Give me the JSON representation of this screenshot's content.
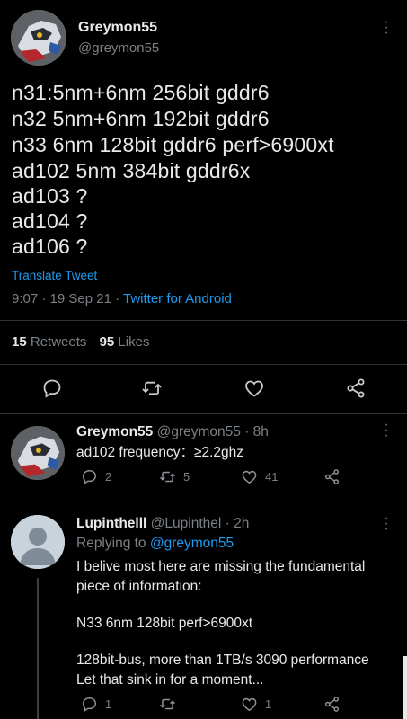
{
  "main_tweet": {
    "display_name": "Greymon55",
    "handle": "@greymon55",
    "lines": [
      "n31:5nm+6nm 256bit gddr6",
      "n32 5nm+6nm 192bit gddr6",
      "n33 6nm 128bit gddr6 perf>6900xt",
      "ad102 5nm 384bit gddr6x",
      "ad103 ?",
      "ad104 ?",
      "ad106 ?"
    ],
    "translate_label": "Translate Tweet",
    "time": "9:07 · 19 Sep 21 · ",
    "source": "Twitter for Android",
    "retweets_count": "15",
    "retweets_label": "Retweets",
    "likes_count": "95",
    "likes_label": "Likes"
  },
  "reply_1": {
    "display_name": "Greymon55",
    "meta": "@greymon55 · 8h",
    "text": "ad102 frequency：≥2.2ghz",
    "replies": "2",
    "retweets": "5",
    "likes": "41"
  },
  "reply_2": {
    "display_name": "Lupinthelll",
    "meta": "@Lupinthel · 2h",
    "replying_prefix": "Replying to ",
    "replying_handle": "@greymon55",
    "text_lines": [
      "I belive most here are missing the fundamental",
      "piece of information:",
      "",
      "N33 6nm 128bit perf>6900xt",
      "",
      "128bit-bus, more than 1TB/s 3090 performance",
      "Let that sink in for a moment..."
    ],
    "replies": "1",
    "likes": "1"
  },
  "colors": {
    "background": "#000000",
    "text": "#e7e9ea",
    "dim": "#7b8085",
    "accent": "#1d9bf0"
  }
}
